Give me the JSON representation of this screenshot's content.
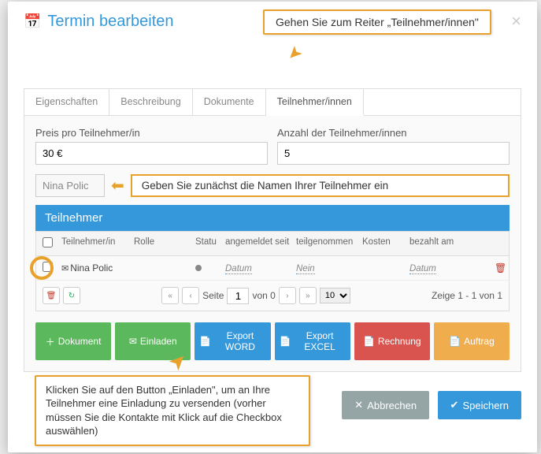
{
  "modal": {
    "title": "Termin bearbeiten"
  },
  "callouts": {
    "top": "Gehen Sie zum Reiter „Teilnehmer/innen\"",
    "name": "Geben Sie zunächst die Namen Ihrer Teilnehmer ein",
    "bottom": "Klicken Sie auf den Button „Einladen\", um an Ihre Teilnehmer eine Einladung zu versenden (vorher müssen Sie die Kontakte mit Klick auf die Checkbox auswählen)"
  },
  "tabs": [
    "Eigenschaften",
    "Beschreibung",
    "Dokumente",
    "Teilnehmer/innen"
  ],
  "fields": {
    "price_label": "Preis pro Teilnehmer/in",
    "price_value": "30 €",
    "count_label": "Anzahl der Teilnehmer/innen",
    "count_value": "5",
    "name_input": "Nina Polic"
  },
  "panel": {
    "title": "Teilnehmer"
  },
  "columns": {
    "name": "Teilnehmer/in",
    "role": "Rolle",
    "status": "Statu",
    "angem": "angemeldet seit",
    "teilg": "teilgenommen",
    "kosten": "Kosten",
    "bezahlt": "bezahlt am"
  },
  "row": {
    "name": "Nina Polic",
    "angem": "Datum",
    "teilg": "Nein",
    "bezahlt": "Datum"
  },
  "pager": {
    "seite": "Seite",
    "page": "1",
    "von": "von 0",
    "pagesize": "10",
    "info": "Zeige 1 - 1 von 1"
  },
  "actions": {
    "dokument": "Dokument",
    "einladen": "Einladen",
    "word": "Export WORD",
    "excel": "Export EXCEL",
    "rechnung": "Rechnung",
    "auftrag": "Auftrag"
  },
  "footer": {
    "cancel": "Abbrechen",
    "save": "Speichern"
  }
}
